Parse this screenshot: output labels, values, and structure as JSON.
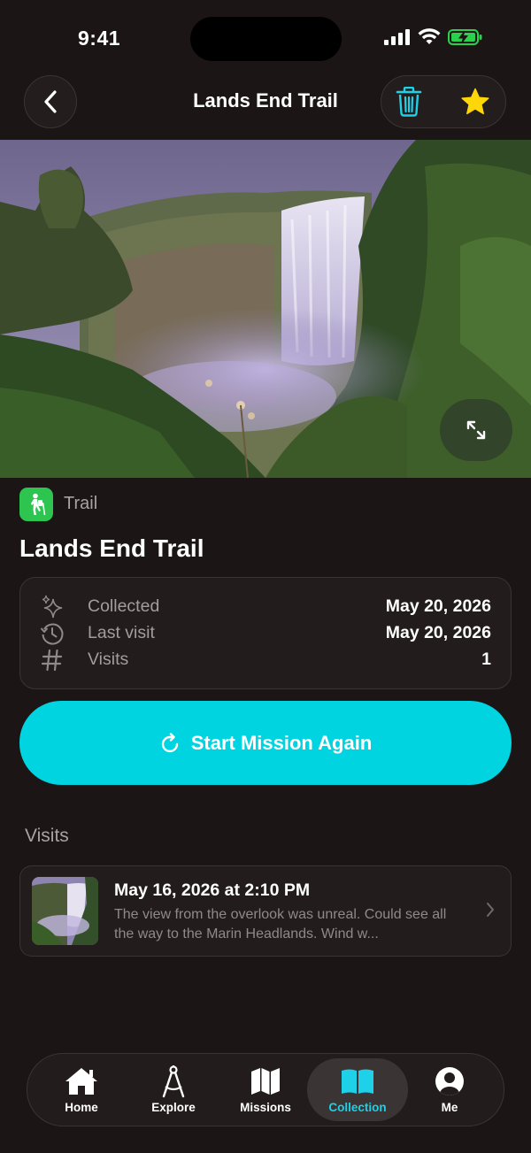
{
  "status_bar": {
    "time": "9:41"
  },
  "nav": {
    "title": "Lands End Trail"
  },
  "place": {
    "category": "Trail",
    "title": "Lands End Trail"
  },
  "info": {
    "collected": {
      "label": "Collected",
      "value": "May 20, 2026"
    },
    "last_visit": {
      "label": "Last visit",
      "value": "May 20, 2026"
    },
    "visits": {
      "label": "Visits",
      "value": "1"
    }
  },
  "cta": {
    "label": "Start Mission Again"
  },
  "visits_section": {
    "heading": "Visits",
    "items": [
      {
        "date": "May 16, 2026 at 2:10 PM",
        "note": "The view from the overlook was unreal. Could see all the way to the Marin Headlands. Wind w..."
      }
    ]
  },
  "tabbar": {
    "active": "Collection",
    "tabs": [
      {
        "label": "Home",
        "icon": "home-icon"
      },
      {
        "label": "Explore",
        "icon": "compass-drafting-icon"
      },
      {
        "label": "Missions",
        "icon": "map-icon"
      },
      {
        "label": "Collection",
        "icon": "book-open-icon"
      },
      {
        "label": "Me",
        "icon": "person-circle-icon"
      }
    ]
  },
  "colors": {
    "background": "#1b1615",
    "accent": "#00d4e0",
    "category_green": "#2dc44f",
    "star": "#ffd60a",
    "trash": "#1ed0e8"
  }
}
